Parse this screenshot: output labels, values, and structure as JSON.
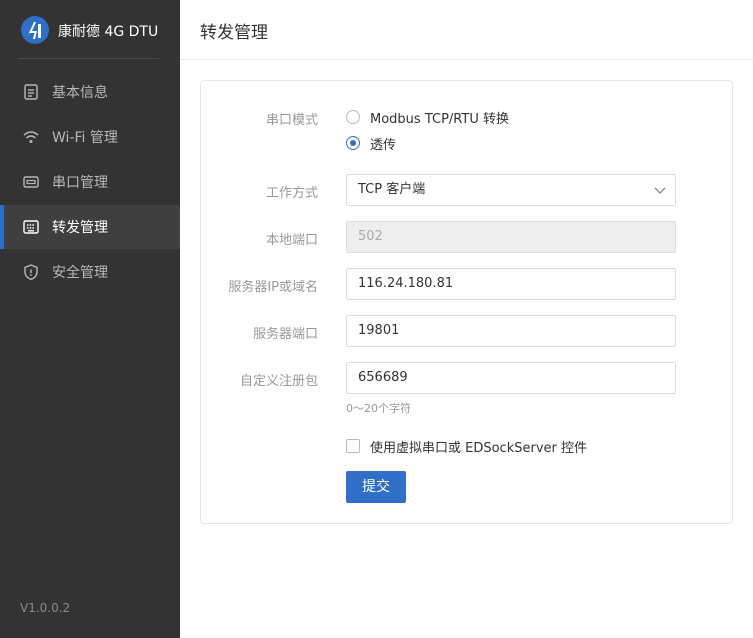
{
  "brand": {
    "title": "康耐德 4G DTU"
  },
  "sidebar": {
    "items": [
      {
        "label": "基本信息",
        "icon": "document-icon"
      },
      {
        "label": "Wi-Fi 管理",
        "icon": "wifi-icon"
      },
      {
        "label": "串口管理",
        "icon": "serial-port-icon"
      },
      {
        "label": "转发管理",
        "icon": "keyboard-icon",
        "active": true
      },
      {
        "label": "安全管理",
        "icon": "shield-icon"
      }
    ],
    "version": "V1.0.0.2"
  },
  "header": {
    "title": "转发管理"
  },
  "form": {
    "serial_mode": {
      "label": "串口模式",
      "options": [
        "Modbus TCP/RTU 转换",
        "透传"
      ],
      "selected": "透传"
    },
    "work_mode": {
      "label": "工作方式",
      "value": "TCP 客户端"
    },
    "local_port": {
      "label": "本地端口",
      "value": "502"
    },
    "server_ip": {
      "label": "服务器IP或域名",
      "value": "116.24.180.81"
    },
    "server_port": {
      "label": "服务器端口",
      "value": "19801"
    },
    "register_packet": {
      "label": "自定义注册包",
      "value": "656689",
      "hint": "0～20个字符"
    },
    "virtual_serial": {
      "label": "使用虚拟串口或 EDSockServer 控件",
      "checked": false
    },
    "submit_label": "提交"
  },
  "colors": {
    "sidebar_bg": "#333333",
    "accent": "#2f6fc7"
  }
}
